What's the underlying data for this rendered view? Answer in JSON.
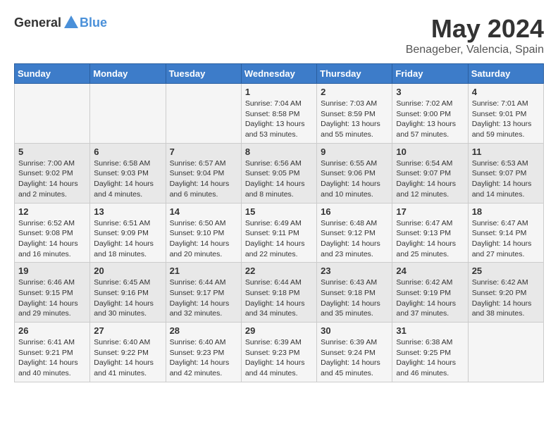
{
  "header": {
    "logo_general": "General",
    "logo_blue": "Blue",
    "month_title": "May 2024",
    "location": "Benageber, Valencia, Spain"
  },
  "calendar": {
    "weekdays": [
      "Sunday",
      "Monday",
      "Tuesday",
      "Wednesday",
      "Thursday",
      "Friday",
      "Saturday"
    ],
    "weeks": [
      [
        {
          "day": "",
          "info": ""
        },
        {
          "day": "",
          "info": ""
        },
        {
          "day": "",
          "info": ""
        },
        {
          "day": "1",
          "info": "Sunrise: 7:04 AM\nSunset: 8:58 PM\nDaylight: 13 hours\nand 53 minutes."
        },
        {
          "day": "2",
          "info": "Sunrise: 7:03 AM\nSunset: 8:59 PM\nDaylight: 13 hours\nand 55 minutes."
        },
        {
          "day": "3",
          "info": "Sunrise: 7:02 AM\nSunset: 9:00 PM\nDaylight: 13 hours\nand 57 minutes."
        },
        {
          "day": "4",
          "info": "Sunrise: 7:01 AM\nSunset: 9:01 PM\nDaylight: 13 hours\nand 59 minutes."
        }
      ],
      [
        {
          "day": "5",
          "info": "Sunrise: 7:00 AM\nSunset: 9:02 PM\nDaylight: 14 hours\nand 2 minutes."
        },
        {
          "day": "6",
          "info": "Sunrise: 6:58 AM\nSunset: 9:03 PM\nDaylight: 14 hours\nand 4 minutes."
        },
        {
          "day": "7",
          "info": "Sunrise: 6:57 AM\nSunset: 9:04 PM\nDaylight: 14 hours\nand 6 minutes."
        },
        {
          "day": "8",
          "info": "Sunrise: 6:56 AM\nSunset: 9:05 PM\nDaylight: 14 hours\nand 8 minutes."
        },
        {
          "day": "9",
          "info": "Sunrise: 6:55 AM\nSunset: 9:06 PM\nDaylight: 14 hours\nand 10 minutes."
        },
        {
          "day": "10",
          "info": "Sunrise: 6:54 AM\nSunset: 9:07 PM\nDaylight: 14 hours\nand 12 minutes."
        },
        {
          "day": "11",
          "info": "Sunrise: 6:53 AM\nSunset: 9:07 PM\nDaylight: 14 hours\nand 14 minutes."
        }
      ],
      [
        {
          "day": "12",
          "info": "Sunrise: 6:52 AM\nSunset: 9:08 PM\nDaylight: 14 hours\nand 16 minutes."
        },
        {
          "day": "13",
          "info": "Sunrise: 6:51 AM\nSunset: 9:09 PM\nDaylight: 14 hours\nand 18 minutes."
        },
        {
          "day": "14",
          "info": "Sunrise: 6:50 AM\nSunset: 9:10 PM\nDaylight: 14 hours\nand 20 minutes."
        },
        {
          "day": "15",
          "info": "Sunrise: 6:49 AM\nSunset: 9:11 PM\nDaylight: 14 hours\nand 22 minutes."
        },
        {
          "day": "16",
          "info": "Sunrise: 6:48 AM\nSunset: 9:12 PM\nDaylight: 14 hours\nand 23 minutes."
        },
        {
          "day": "17",
          "info": "Sunrise: 6:47 AM\nSunset: 9:13 PM\nDaylight: 14 hours\nand 25 minutes."
        },
        {
          "day": "18",
          "info": "Sunrise: 6:47 AM\nSunset: 9:14 PM\nDaylight: 14 hours\nand 27 minutes."
        }
      ],
      [
        {
          "day": "19",
          "info": "Sunrise: 6:46 AM\nSunset: 9:15 PM\nDaylight: 14 hours\nand 29 minutes."
        },
        {
          "day": "20",
          "info": "Sunrise: 6:45 AM\nSunset: 9:16 PM\nDaylight: 14 hours\nand 30 minutes."
        },
        {
          "day": "21",
          "info": "Sunrise: 6:44 AM\nSunset: 9:17 PM\nDaylight: 14 hours\nand 32 minutes."
        },
        {
          "day": "22",
          "info": "Sunrise: 6:44 AM\nSunset: 9:18 PM\nDaylight: 14 hours\nand 34 minutes."
        },
        {
          "day": "23",
          "info": "Sunrise: 6:43 AM\nSunset: 9:18 PM\nDaylight: 14 hours\nand 35 minutes."
        },
        {
          "day": "24",
          "info": "Sunrise: 6:42 AM\nSunset: 9:19 PM\nDaylight: 14 hours\nand 37 minutes."
        },
        {
          "day": "25",
          "info": "Sunrise: 6:42 AM\nSunset: 9:20 PM\nDaylight: 14 hours\nand 38 minutes."
        }
      ],
      [
        {
          "day": "26",
          "info": "Sunrise: 6:41 AM\nSunset: 9:21 PM\nDaylight: 14 hours\nand 40 minutes."
        },
        {
          "day": "27",
          "info": "Sunrise: 6:40 AM\nSunset: 9:22 PM\nDaylight: 14 hours\nand 41 minutes."
        },
        {
          "day": "28",
          "info": "Sunrise: 6:40 AM\nSunset: 9:23 PM\nDaylight: 14 hours\nand 42 minutes."
        },
        {
          "day": "29",
          "info": "Sunrise: 6:39 AM\nSunset: 9:23 PM\nDaylight: 14 hours\nand 44 minutes."
        },
        {
          "day": "30",
          "info": "Sunrise: 6:39 AM\nSunset: 9:24 PM\nDaylight: 14 hours\nand 45 minutes."
        },
        {
          "day": "31",
          "info": "Sunrise: 6:38 AM\nSunset: 9:25 PM\nDaylight: 14 hours\nand 46 minutes."
        },
        {
          "day": "",
          "info": ""
        }
      ]
    ]
  }
}
